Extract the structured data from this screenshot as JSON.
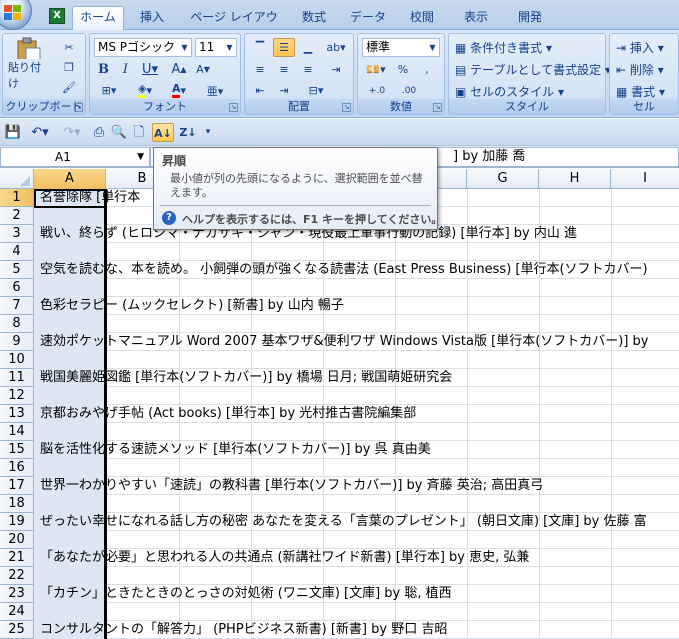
{
  "ribbon_tabs": [
    "ホーム",
    "挿入",
    "ページ レイアウト",
    "数式",
    "データ",
    "校閲",
    "表示",
    "開発"
  ],
  "groups": {
    "clipboard": {
      "label": "クリップボード",
      "paste": "貼り付け"
    },
    "font": {
      "label": "フォント",
      "font_name": "MS Pゴシック",
      "font_size": "11"
    },
    "alignment": {
      "label": "配置"
    },
    "number": {
      "label": "数値",
      "format": "標準"
    },
    "styles": {
      "label": "スタイル",
      "conditional": "条件付き書式",
      "table": "テーブルとして書式設定",
      "cell_style": "セルのスタイル"
    },
    "cells": {
      "label": "セル",
      "insert": "挿入",
      "delete": "削除",
      "format": "書式"
    }
  },
  "name_box": "A1",
  "formula_text": "] by 加藤 喬",
  "tooltip": {
    "title": "昇順",
    "body": "最小値が列の先頭になるように、選択範囲を並べ替えます。",
    "help": "ヘルプを表示するには、F1 キーを押してください。"
  },
  "columns": [
    "A",
    "B",
    "C",
    "D",
    "E",
    "F",
    "G",
    "H",
    "I"
  ],
  "rows": [
    {
      "n": "1",
      "text": "名誉除隊 [単行本"
    },
    {
      "n": "2",
      "text": ""
    },
    {
      "n": "3",
      "text": "戦い、終らず (ヒロシマ・ナガサキ・ジャン・現役最上軍事行動の記録) [単行本] by 内山 進"
    },
    {
      "n": "4",
      "text": ""
    },
    {
      "n": "5",
      "text": "空気を読むな、本を読め。 小飼弾の頭が強くなる読書法 (East Press Business) [単行本(ソフトカバー)"
    },
    {
      "n": "6",
      "text": ""
    },
    {
      "n": "7",
      "text": "色彩セラピー (ムックセレクト) [新書] by 山内 暢子"
    },
    {
      "n": "8",
      "text": ""
    },
    {
      "n": "9",
      "text": "速効ポケットマニュアル Word 2007 基本ワザ&便利ワザ Windows Vista版 [単行本(ソフトカバー)] by"
    },
    {
      "n": "10",
      "text": ""
    },
    {
      "n": "11",
      "text": "戦国美麗姫図鑑 [単行本(ソフトカバー)] by 橋場 日月; 戦国萌姫研究会"
    },
    {
      "n": "12",
      "text": ""
    },
    {
      "n": "13",
      "text": "京都おみやげ手帖 (Act books) [単行本] by 光村推古書院編集部"
    },
    {
      "n": "14",
      "text": ""
    },
    {
      "n": "15",
      "text": "脳を活性化する速読メソッド [単行本(ソフトカバー)] by 呉 真由美"
    },
    {
      "n": "16",
      "text": ""
    },
    {
      "n": "17",
      "text": "世界一わかりやすい「速読」の教科書 [単行本(ソフトカバー)] by 斉藤 英治; 高田真弓"
    },
    {
      "n": "18",
      "text": ""
    },
    {
      "n": "19",
      "text": "ぜったい幸せになれる話し方の秘密 あなたを変える「言葉のプレゼント」 (朝日文庫) [文庫] by 佐藤 富"
    },
    {
      "n": "20",
      "text": ""
    },
    {
      "n": "21",
      "text": "「あなたが必要」と思われる人の共通点 (新講社ワイド新書) [単行本] by 恵史, 弘兼"
    },
    {
      "n": "22",
      "text": ""
    },
    {
      "n": "23",
      "text": "「カチン」ときたときのとっさの対処術 (ワニ文庫) [文庫] by 聡, 植西"
    },
    {
      "n": "24",
      "text": ""
    },
    {
      "n": "25",
      "text": "コンサルタントの「解答力」 (PHPビジネス新書) [新書] by 野口 吉昭"
    }
  ]
}
